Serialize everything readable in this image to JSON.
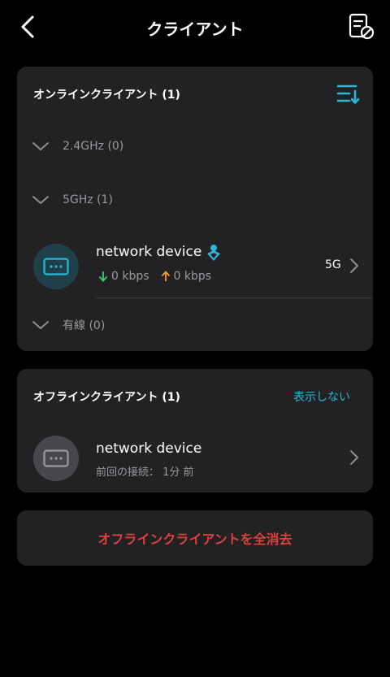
{
  "header": {
    "title": "クライアント",
    "back_icon": "chevron-left-icon",
    "action_icon": "document-block-icon"
  },
  "online": {
    "title": "オンラインクライアント (1)",
    "sort_icon": "sort-list-icon",
    "bands": [
      {
        "label": "2.4GHz (0)"
      },
      {
        "label": "5GHz (1)"
      },
      {
        "label": "有線 (0)"
      }
    ],
    "device": {
      "name": "network device",
      "badge_icon": "person-badge-icon",
      "download": "0 kbps",
      "upload": "0 kbps",
      "band": "5G"
    }
  },
  "offline": {
    "title": "オフラインクライアント (1)",
    "hide_label": "表示しない",
    "device": {
      "name": "network device",
      "last_seen": "前回の接続： 1分 前"
    }
  },
  "clear_button": {
    "label": "オフラインクライアントを全消去"
  },
  "colors": {
    "accent": "#29b6d8",
    "danger": "#e0413a",
    "download": "#3ad06b",
    "upload": "#f0a030",
    "card_bg": "#222224"
  }
}
